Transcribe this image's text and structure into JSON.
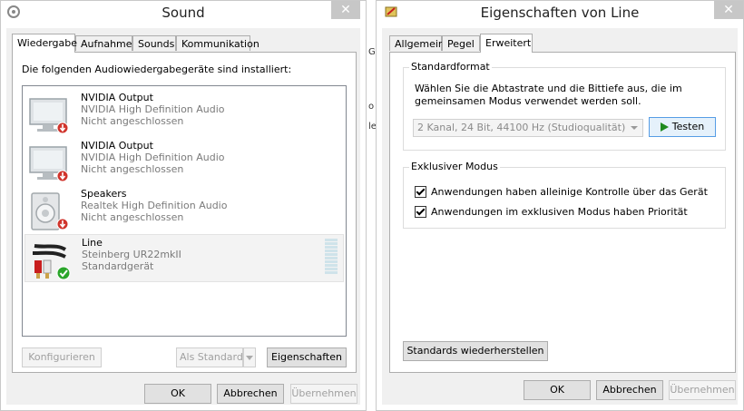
{
  "sound": {
    "title": "Sound",
    "close": "✕",
    "tabs": [
      "Wiedergabe",
      "Aufnahme",
      "Sounds",
      "Kommunikation"
    ],
    "instruction": "Die folgenden Audiowiedergabegeräte sind installiert:",
    "devices": [
      {
        "name": "NVIDIA Output",
        "driver": "NVIDIA High Definition Audio",
        "status": "Nicht angeschlossen",
        "icon": "monitor-icon",
        "badge": "disconnected-icon"
      },
      {
        "name": "NVIDIA Output",
        "driver": "NVIDIA High Definition Audio",
        "status": "Nicht angeschlossen",
        "icon": "monitor-icon",
        "badge": "disconnected-icon"
      },
      {
        "name": "Speakers",
        "driver": "Realtek High Definition Audio",
        "status": "Nicht angeschlossen",
        "icon": "speaker-icon",
        "badge": "disconnected-icon"
      },
      {
        "name": "Line",
        "driver": "Steinberg UR22mkII",
        "status": "Standardgerät",
        "icon": "rca-cable-icon",
        "badge": "default-check-icon"
      }
    ],
    "configure": "Konfigurieren",
    "set_default": "Als Standard",
    "properties": "Eigenschaften",
    "ok": "OK",
    "cancel": "Abbrechen",
    "apply": "Übernehmen"
  },
  "props": {
    "title": "Eigenschaften von Line",
    "close": "✕",
    "tabs": [
      "Allgemein",
      "Pegel",
      "Erweitert"
    ],
    "format_group": "Standardformat",
    "format_desc1": "Wählen Sie die Abtastrate und die Bittiefe aus, die im",
    "format_desc2": "gemeinsamen Modus verwendet werden soll.",
    "format_value": "2 Kanal, 24 Bit, 44100 Hz (Studioqualität)",
    "test": "Testen",
    "exclusive_group": "Exklusiver Modus",
    "exclusive_control": "Anwendungen haben alleinige Kontrolle über das Gerät",
    "exclusive_priority": "Anwendungen im exklusiven Modus haben Priorität",
    "restore_defaults": "Standards wiederherstellen",
    "ok": "OK",
    "cancel": "Abbrechen",
    "apply": "Übernehmen"
  },
  "background_fragments": [
    "G",
    "o",
    "le"
  ],
  "colors": {
    "check_green": "#2aa52a",
    "disconnect_red": "#d0342c",
    "test_arrow": "#1e8a1e"
  }
}
